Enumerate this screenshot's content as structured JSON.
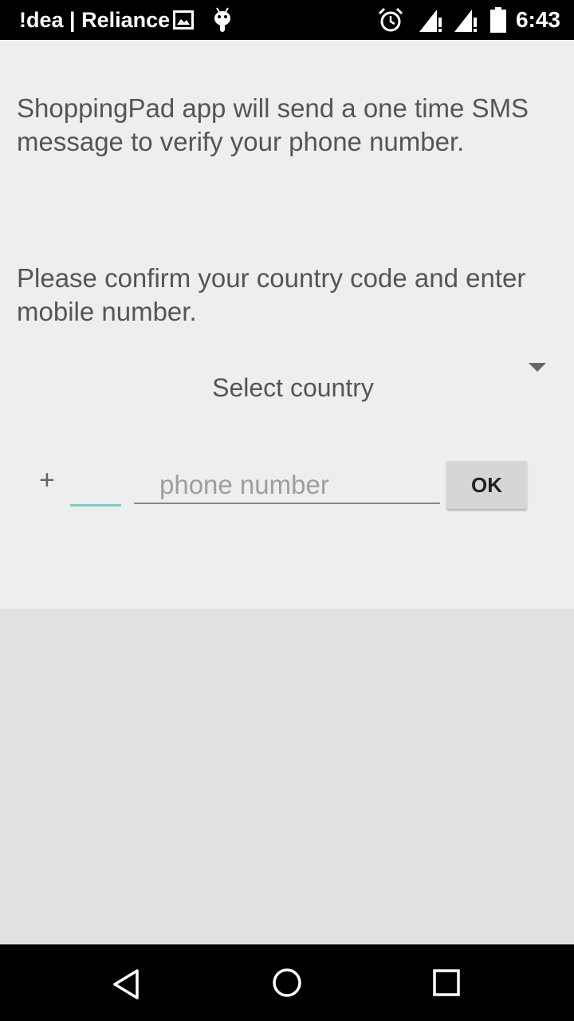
{
  "status_bar": {
    "carrier": "!dea | Reliance",
    "time": "6:43",
    "icons": [
      "image-notification-icon",
      "android-debug-icon",
      "alarm-icon",
      "signal-icon",
      "signal-icon",
      "battery-icon"
    ]
  },
  "intro": {
    "sms_notice": "ShoppingPad app will send a one time SMS message to verify your phone number.",
    "confirm_prompt": "Please confirm your country code and enter mobile number."
  },
  "country_select": {
    "label": "Select country",
    "icon": "dropdown-arrow-icon"
  },
  "phone_form": {
    "plus_sign": "+",
    "country_code_value": "",
    "phone_placeholder": "phone number",
    "phone_value": "",
    "ok_label": "OK"
  },
  "nav_bar": {
    "icons": [
      "back-icon",
      "home-icon",
      "recents-icon"
    ]
  },
  "colors": {
    "accent": "#80cbc4",
    "background": "#eeeeee"
  }
}
